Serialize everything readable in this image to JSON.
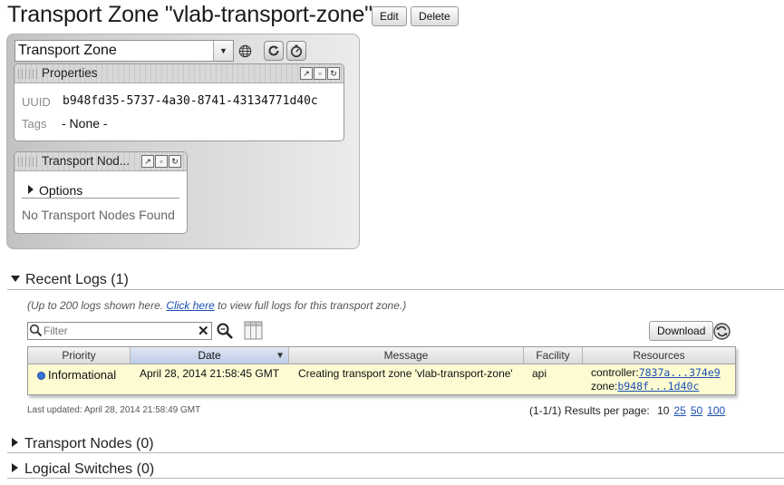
{
  "header": {
    "title": "Transport Zone \"vlab-transport-zone\"",
    "edit_label": "Edit",
    "delete_label": "Delete"
  },
  "view_select": {
    "selected": "Transport Zone"
  },
  "properties_portlet": {
    "title": "Properties",
    "uuid_label": "UUID",
    "uuid_value": "b948fd35-5737-4a30-8741-43134771d40c",
    "tags_label": "Tags",
    "tags_value": "- None -"
  },
  "transport_nodes_portlet": {
    "title": "Transport Nod...",
    "options_label": "Options",
    "empty_text": "No Transport Nodes Found"
  },
  "recent_logs": {
    "heading": "Recent Logs (1)",
    "note_prefix": "(Up to 200 logs shown here. ",
    "note_link": "Click here",
    "note_suffix": " to view full logs for this transport zone.)",
    "filter_placeholder": "Filter",
    "download_label": "Download",
    "columns": [
      "Priority",
      "Date",
      "Message",
      "Facility",
      "Resources"
    ],
    "rows": [
      {
        "priority": "Informational",
        "date": "April 28, 2014 21:58:45 GMT",
        "message": "Creating transport zone 'vlab-transport-zone'",
        "facility": "api",
        "res1_label": "controller:",
        "res1_link": "7837a...374e9",
        "res2_label": "zone:",
        "res2_link": "b948f...1d40c"
      }
    ],
    "last_updated": "Last updated: April 28, 2014 21:58:49 GMT",
    "range": "(1-1/1)",
    "results_per_page_label": "Results per page:",
    "per_page_current": "10",
    "per_page_options": [
      "25",
      "50",
      "100"
    ]
  },
  "sections": {
    "transport_nodes": "Transport Nodes (0)",
    "logical_switches": "Logical Switches (0)"
  },
  "colors": {
    "link": "#1b4fb4",
    "selected_row": "#fdfbd2",
    "priority_dot": "#3a73d8"
  }
}
